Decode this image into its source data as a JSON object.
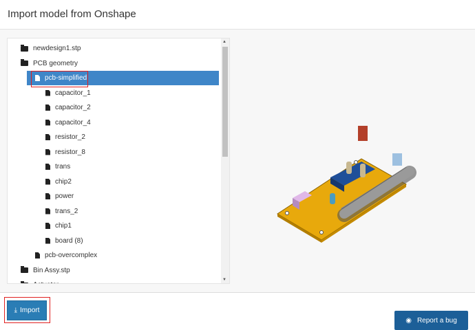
{
  "header": {
    "title": "Import model from Onshape"
  },
  "tree": {
    "items": [
      {
        "label": "newdesign1.stp",
        "icon": "folder-icon",
        "level": 0
      },
      {
        "label": "PCB geometry",
        "icon": "folder-open-icon",
        "level": 0
      },
      {
        "label": "pcb-simplified",
        "icon": "file-icon",
        "level": 1,
        "selected": true
      },
      {
        "label": "capacitor_1",
        "icon": "file-icon",
        "level": 2
      },
      {
        "label": "capacitor_2",
        "icon": "file-icon",
        "level": 2
      },
      {
        "label": "capacitor_4",
        "icon": "file-icon",
        "level": 2
      },
      {
        "label": "resistor_2",
        "icon": "file-icon",
        "level": 2
      },
      {
        "label": "resistor_8",
        "icon": "file-icon",
        "level": 2
      },
      {
        "label": "trans",
        "icon": "file-icon",
        "level": 2
      },
      {
        "label": "chip2",
        "icon": "file-icon",
        "level": 2
      },
      {
        "label": "power",
        "icon": "file-icon",
        "level": 2
      },
      {
        "label": "trans_2",
        "icon": "file-icon",
        "level": 2
      },
      {
        "label": "chip1",
        "icon": "file-icon",
        "level": 2
      },
      {
        "label": "board (8)",
        "icon": "file-icon",
        "level": 2
      },
      {
        "label": "pcb-overcomplex",
        "icon": "file-icon",
        "level": 1
      },
      {
        "label": "Bin Assy.stp",
        "icon": "folder-icon",
        "level": 0
      },
      {
        "label": "Actuator",
        "icon": "folder-icon",
        "level": 0
      }
    ]
  },
  "footer": {
    "import_label": "Import",
    "report_label": "Report a bug"
  }
}
